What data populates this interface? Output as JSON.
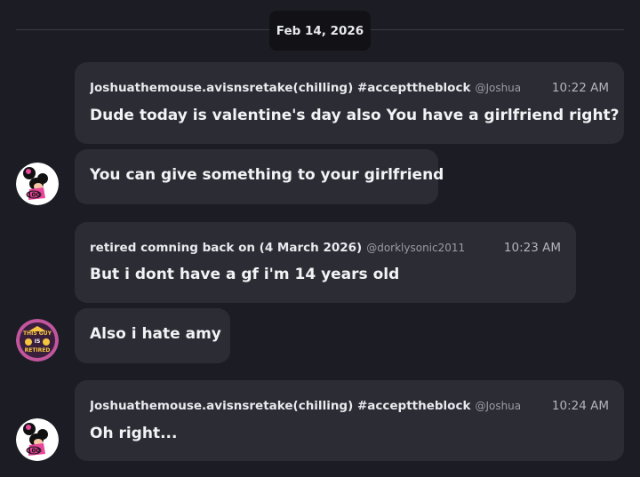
{
  "date_separator": "Feb 14, 2026",
  "users": {
    "joshua": {
      "display_name": "Joshuathemouse.avisnsretake(chilling) #accepttheblock",
      "handle": "@Joshua"
    },
    "retired": {
      "display_name": "retired comning back on (4 March 2026)",
      "handle": "@dorklysonic2011"
    }
  },
  "messages": [
    {
      "time": "10:22 AM",
      "text": "Dude today is valentine's day also You have a girlfriend right?"
    },
    {
      "text": "You can give something to your girlfriend"
    },
    {
      "time": "10:23 AM",
      "text": "But i dont have a gf i'm 14 years old"
    },
    {
      "text": "Also i hate amy"
    },
    {
      "time": "10:24 AM",
      "text": "Oh right..."
    }
  ],
  "avatar_text": {
    "mickey_badge": "100",
    "retired_badge_top": "THIS GUY",
    "retired_badge_mid": "IS",
    "retired_badge_bottom": "RETIRED"
  },
  "colors": {
    "background": "#1c1c24",
    "bubble": "#2b2c34",
    "date_pill": "#111116",
    "mickey_pink": "#e8469b"
  }
}
